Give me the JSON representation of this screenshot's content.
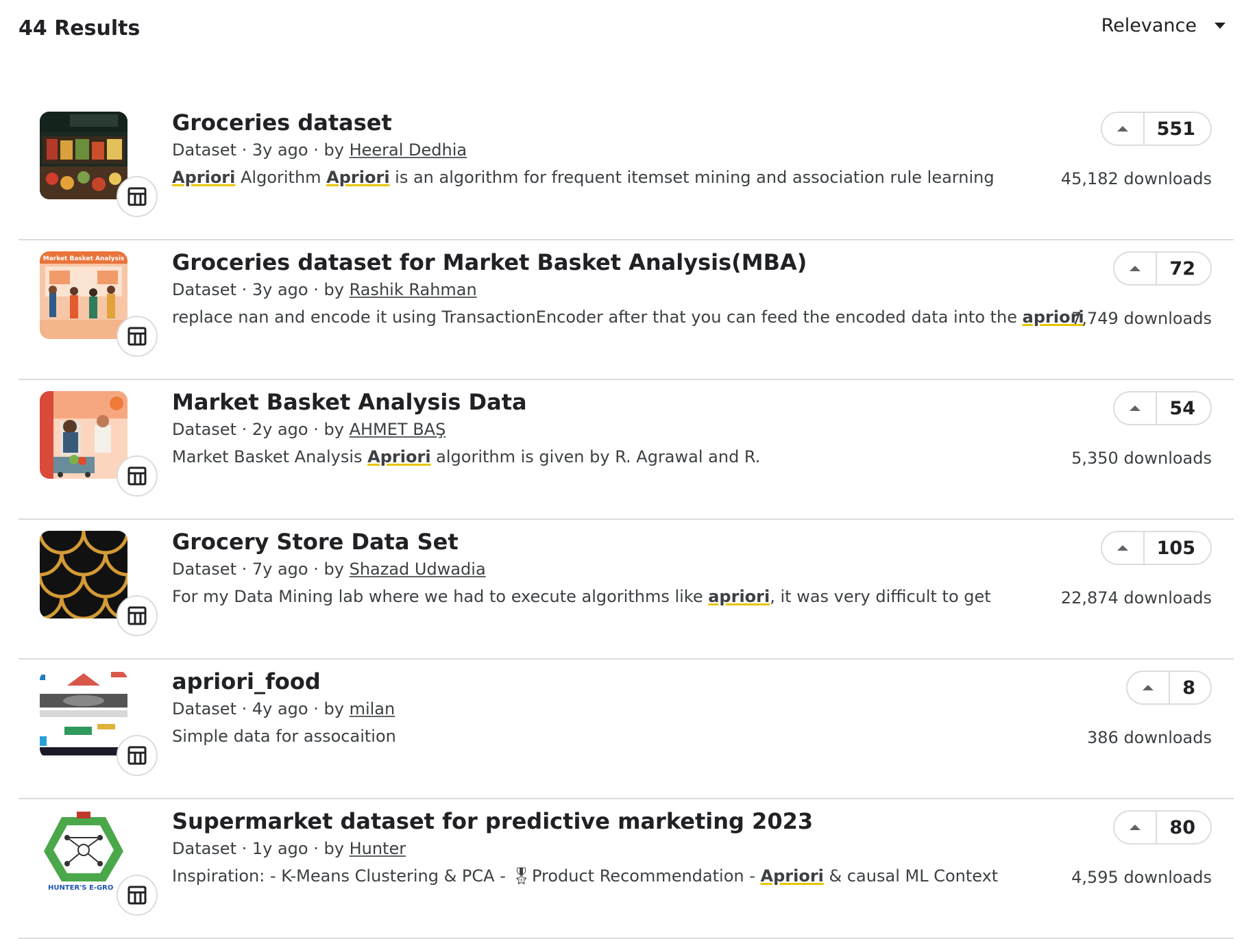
{
  "header": {
    "results_count": "44 Results",
    "sort_label": "Relevance"
  },
  "colors": {
    "highlight_underline": "#e8c400",
    "divider": "#dadce0",
    "text": "#202124"
  },
  "results": [
    {
      "title": "Groceries dataset",
      "type": "Dataset",
      "age": "3y ago",
      "by": "by",
      "author": "Heeral Dedhia",
      "desc": [
        {
          "t": "Apriori",
          "hl": true
        },
        {
          "t": " Algorithm ",
          "hl": false
        },
        {
          "t": "Apriori",
          "hl": true
        },
        {
          "t": " is an algorithm for frequent itemset mining and association rule learning",
          "hl": false
        }
      ],
      "votes": "551",
      "downloads": "45,182 downloads",
      "thumb_icon": "grocery-store-photo"
    },
    {
      "title": "Groceries dataset for Market Basket Analysis(MBA)",
      "type": "Dataset",
      "age": "3y ago",
      "by": "by",
      "author": "Rashik Rahman",
      "thumb_text": "Market Basket Analysis",
      "desc": [
        {
          "t": "replace nan and encode it using TransactionEncoder after that you can feed the encoded data into the ",
          "hl": false
        },
        {
          "t": "apriori",
          "hl": true
        }
      ],
      "votes": "72",
      "downloads": "7,749 downloads",
      "thumb_icon": "shoppers-illustration"
    },
    {
      "title": "Market Basket Analysis Data",
      "type": "Dataset",
      "age": "2y ago",
      "by": "by",
      "author": "AHMET BAŞ",
      "desc": [
        {
          "t": "Market Basket Analysis ",
          "hl": false
        },
        {
          "t": "Apriori",
          "hl": true
        },
        {
          "t": " algorithm is given by R. Agrawal and R.",
          "hl": false
        }
      ],
      "votes": "54",
      "downloads": "5,350 downloads",
      "thumb_icon": "supermarket-illustration"
    },
    {
      "title": "Grocery Store Data Set",
      "type": "Dataset",
      "age": "7y ago",
      "by": "by",
      "author": "Shazad Udwadia",
      "desc": [
        {
          "t": "For my Data Mining lab where we had to execute algorithms like ",
          "hl": false
        },
        {
          "t": "apriori",
          "hl": true
        },
        {
          "t": ", it was very difficult to get",
          "hl": false
        }
      ],
      "votes": "105",
      "downloads": "22,874 downloads",
      "thumb_icon": "scale-pattern"
    },
    {
      "title": "apriori_food",
      "type": "Dataset",
      "age": "4y ago",
      "by": "by",
      "author": "milan",
      "desc": [
        {
          "t": "Simple data for assocaition",
          "hl": false
        }
      ],
      "votes": "8",
      "downloads": "386 downloads",
      "thumb_icon": "food-collage"
    },
    {
      "title": "Supermarket dataset for predictive marketing 2023",
      "type": "Dataset",
      "age": "1y ago",
      "by": "by",
      "author": "Hunter",
      "thumb_text": "HUNTER'S E-GRO",
      "desc": [
        {
          "t": "Inspiration: - K-Means Clustering & PCA - ",
          "hl": false
        },
        {
          "t": "🎖",
          "hl": false
        },
        {
          "t": "Product Recommendation - ",
          "hl": false
        },
        {
          "t": "Apriori",
          "hl": true
        },
        {
          "t": " & causal ML Context",
          "hl": false
        }
      ],
      "votes": "80",
      "downloads": "4,595 downloads",
      "thumb_icon": "hunters-egrocery-logo"
    }
  ]
}
